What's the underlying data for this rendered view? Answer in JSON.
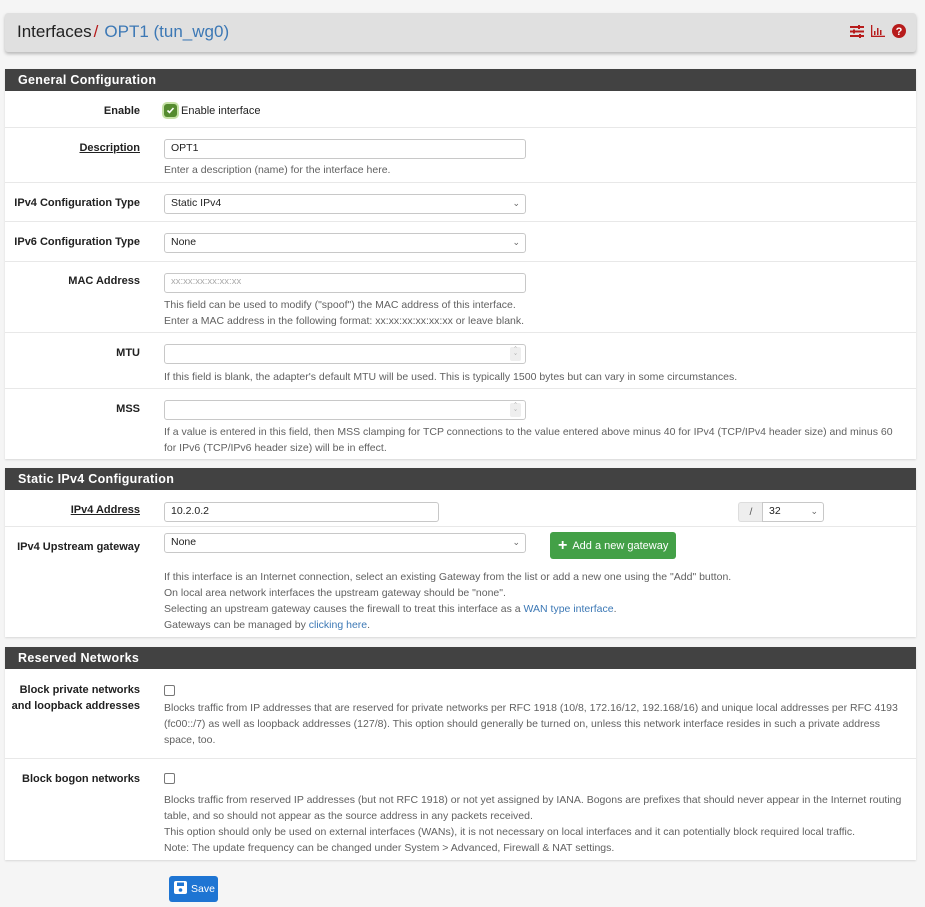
{
  "header": {
    "breadcrumb_root": "Interfaces",
    "separator": "/",
    "current": "OPT1 (tun_wg0)",
    "icons": [
      "sliders-icon",
      "bar-chart-icon",
      "help-icon"
    ]
  },
  "general": {
    "title": "General Configuration",
    "enable": {
      "label": "Enable",
      "checkbox_label": "Enable interface",
      "checked": true
    },
    "description": {
      "label": "Description",
      "value": "OPT1",
      "help": "Enter a description (name) for the interface here."
    },
    "ipv4_type": {
      "label": "IPv4 Configuration Type",
      "value": "Static IPv4"
    },
    "ipv6_type": {
      "label": "IPv6 Configuration Type",
      "value": "None"
    },
    "mac": {
      "label": "MAC Address",
      "placeholder": "xx:xx:xx:xx:xx:xx",
      "help1": "This field can be used to modify (\"spoof\") the MAC address of this interface.",
      "help2": "Enter a MAC address in the following format: xx:xx:xx:xx:xx:xx or leave blank."
    },
    "mtu": {
      "label": "MTU",
      "value": "",
      "help": "If this field is blank, the adapter's default MTU will be used. This is typically 1500 bytes but can vary in some circumstances."
    },
    "mss": {
      "label": "MSS",
      "value": "",
      "help": "If a value is entered in this field, then MSS clamping for TCP connections to the value entered above minus 40 for IPv4 (TCP/IPv4 header size) and minus 60 for IPv6 (TCP/IPv6 header size) will be in effect."
    }
  },
  "static_ipv4": {
    "title": "Static IPv4 Configuration",
    "address": {
      "label": "IPv4 Address",
      "value": "10.2.0.2",
      "slash": "/",
      "cidr": "32"
    },
    "gateway": {
      "label": "IPv4 Upstream gateway",
      "value": "None",
      "add_button": "Add a new gateway",
      "help1": "If this interface is an Internet connection, select an existing Gateway from the list or add a new one using the \"Add\" button.",
      "help2": "On local area network interfaces the upstream gateway should be \"none\".",
      "help3_prefix": "Selecting an upstream gateway causes the firewall to treat this interface as a ",
      "help3_link": "WAN type interface",
      "help3_suffix": ".",
      "help4_prefix": "Gateways can be managed by ",
      "help4_link": "clicking here",
      "help4_suffix": "."
    }
  },
  "reserved": {
    "title": "Reserved Networks",
    "private": {
      "label1": "Block private networks",
      "label2": "and loopback addresses",
      "checked": false,
      "help": "Blocks traffic from IP addresses that are reserved for private networks per RFC 1918 (10/8, 172.16/12, 192.168/16) and unique local addresses per RFC 4193 (fc00::/7) as well as loopback addresses (127/8). This option should generally be turned on, unless this network interface resides in such a private address space, too."
    },
    "bogon": {
      "label": "Block bogon networks",
      "checked": false,
      "help1": "Blocks traffic from reserved IP addresses (but not RFC 1918) or not yet assigned by IANA. Bogons are prefixes that should never appear in the Internet routing table, and so should not appear as the source address in any packets received.",
      "help2": "This option should only be used on external interfaces (WANs), it is not necessary on local interfaces and it can potentially block required local traffic.",
      "help3": "Note: The update frequency can be changed under System > Advanced, Firewall & NAT settings."
    }
  },
  "actions": {
    "save": "Save"
  },
  "colors": {
    "accent_red": "#b71c1c",
    "link_blue": "#3c78b5",
    "green": "#43a047",
    "save_blue": "#1e75d3",
    "panel_head": "#424242"
  }
}
